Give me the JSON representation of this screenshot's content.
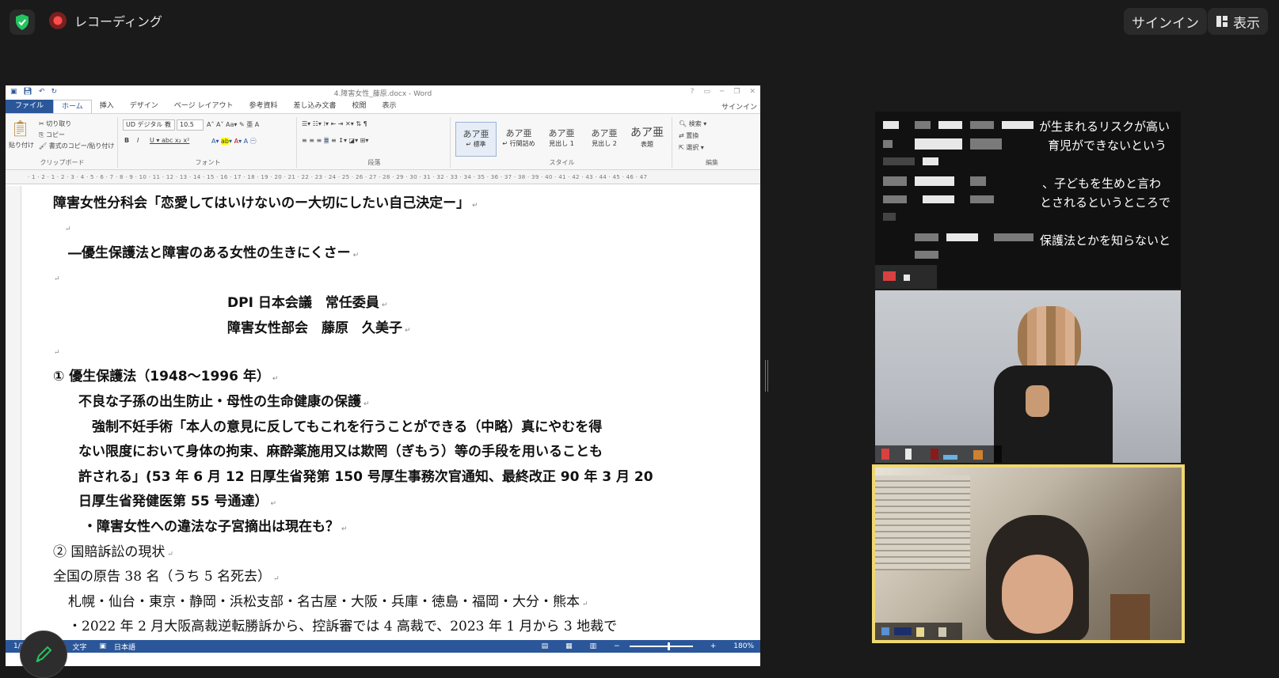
{
  "zoom": {
    "recording_label": "レコーディング",
    "signin_label": "サインイン",
    "view_label": "表示"
  },
  "word": {
    "title": "4.障害女性_藤原.docx - Word",
    "signin": "サインイン",
    "tabs": [
      "ファイル",
      "ホーム",
      "挿入",
      "デザイン",
      "ページ レイアウト",
      "参考資料",
      "差し込み文書",
      "校閲",
      "表示"
    ],
    "clipboard": {
      "paste": "貼り付け",
      "cut": "切り取り",
      "copy": "コピー",
      "format_painter": "書式のコピー/貼り付け",
      "label": "クリップボード"
    },
    "font": {
      "name": "UD デジタル 教",
      "size": "10.5",
      "label": "フォント"
    },
    "paragraph_label": "段落",
    "styles": {
      "items": [
        {
          "preview": "あア亜",
          "name": "↵ 標準"
        },
        {
          "preview": "あア亜",
          "name": "↵ 行間詰め"
        },
        {
          "preview": "あア亜",
          "name": "見出し 1"
        },
        {
          "preview": "あア亜",
          "name": "見出し 2"
        },
        {
          "preview": "あア亜",
          "name": "表題"
        }
      ],
      "label": "スタイル"
    },
    "editing": {
      "find": "検索",
      "replace": "置換",
      "select": "選択",
      "label": "編集"
    },
    "document": {
      "lines": [
        "障害女性分科会「恋愛してはいけないのー大切にしたい自己決定ー」",
        "―優生保護法と障害のある女性の生きにくさー",
        "DPI 日本会議　常任委員",
        "障害女性部会　藤原　久美子",
        "① 優生保護法（1948～1996 年）",
        "不良な子孫の出生防止・母性の生命健康の保護",
        "　強制不妊手術「本人の意見に反してもこれを行うことができる（中略）真にやむを得",
        "ない限度において身体の拘束、麻酔薬施用又は欺罔（ぎもう）等の手段を用いることも",
        "許される」(53 年 6 月 12 日厚生省発第 150 号厚生事務次官通知、最終改正 90 年 3 月 20",
        "日厚生省発健医第 55 号通達）",
        "・障害女性への違法な子宮摘出は現在も？",
        "② 国賠訴訟の現状",
        "全国の原告 38 名（うち 5 名死去）",
        "札幌・仙台・東京・静岡・浜松支部・名古屋・大阪・兵庫・徳島・福岡・大分・熊本",
        "・2022 年 2 月大阪高裁逆転勝訴から、控訴審では 4 高裁で、2023 年 1 月から 3 地裁で"
      ]
    },
    "status": {
      "page": "1/1",
      "words": "文字",
      "language": "日本語",
      "zoom": "180%"
    }
  },
  "captions": {
    "lines": [
      "が生まれるリスクが高い",
      "育児ができないという",
      "、子どもを生めと言わ",
      "とされるというところで",
      "保護法とかを知らないと"
    ]
  }
}
